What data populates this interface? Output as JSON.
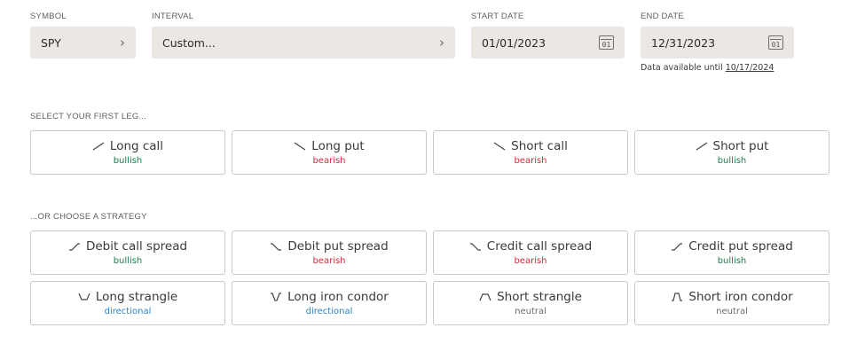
{
  "symbol": {
    "label": "SYMBOL",
    "value": "SPY"
  },
  "interval": {
    "label": "INTERVAL",
    "value": "Custom..."
  },
  "start_date": {
    "label": "START DATE",
    "value": "01/01/2023",
    "icon_text": "01"
  },
  "end_date": {
    "label": "END DATE",
    "value": "12/31/2023",
    "icon_text": "01"
  },
  "availability": {
    "prefix": "Data available until",
    "date": "10/17/2024"
  },
  "first_leg": {
    "heading": "SELECT YOUR FIRST LEG...",
    "items": [
      {
        "title": "Long call",
        "sentiment": "bullish",
        "icon": "rising-line-icon"
      },
      {
        "title": "Long put",
        "sentiment": "bearish",
        "icon": "falling-line-icon"
      },
      {
        "title": "Short call",
        "sentiment": "bearish",
        "icon": "falling-line-icon"
      },
      {
        "title": "Short put",
        "sentiment": "bullish",
        "icon": "rising-line-icon"
      }
    ]
  },
  "strategy": {
    "heading": "...OR CHOOSE A STRATEGY",
    "items": [
      {
        "title": "Debit call spread",
        "sentiment": "bullish",
        "icon": "rising-spread-icon"
      },
      {
        "title": "Debit put spread",
        "sentiment": "bearish",
        "icon": "falling-spread-icon"
      },
      {
        "title": "Credit call spread",
        "sentiment": "bearish",
        "icon": "falling-spread-icon"
      },
      {
        "title": "Credit put spread",
        "sentiment": "bullish",
        "icon": "rising-spread-icon"
      },
      {
        "title": "Long strangle",
        "sentiment": "directional",
        "icon": "v-shape-icon"
      },
      {
        "title": "Long iron condor",
        "sentiment": "directional",
        "icon": "notched-v-icon"
      },
      {
        "title": "Short strangle",
        "sentiment": "neutral",
        "icon": "inverted-v-icon"
      },
      {
        "title": "Short iron condor",
        "sentiment": "neutral",
        "icon": "plateau-icon"
      }
    ]
  },
  "colors": {
    "bullish": "#1f7a4a",
    "bearish": "#d12a3a",
    "directional": "#2a82c9",
    "neutral": "#6b6b6b",
    "field_bg": "#ebe7e3"
  }
}
